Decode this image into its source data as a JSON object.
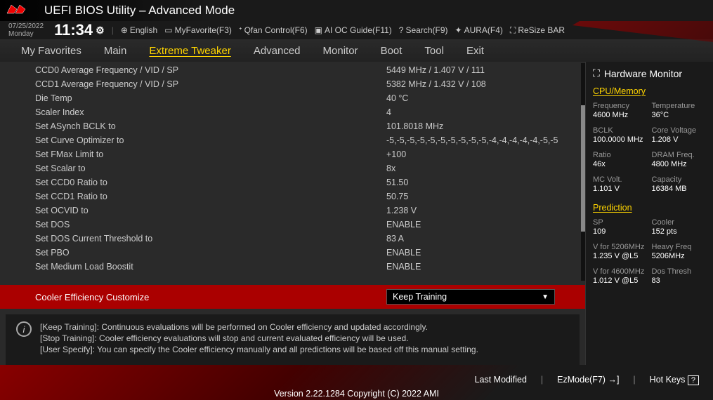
{
  "header": {
    "title": "UEFI BIOS Utility – Advanced Mode"
  },
  "datetime": {
    "date": "07/25/2022",
    "day": "Monday",
    "time": "11:34"
  },
  "toolbar": {
    "language": "English",
    "favorite": "MyFavorite(F3)",
    "qfan": "Qfan Control(F6)",
    "aioc": "AI OC Guide(F11)",
    "search": "Search(F9)",
    "aura": "AURA(F4)",
    "resize": "ReSize BAR"
  },
  "tabs": [
    "My Favorites",
    "Main",
    "Extreme Tweaker",
    "Advanced",
    "Monitor",
    "Boot",
    "Tool",
    "Exit"
  ],
  "active_tab": "Extreme Tweaker",
  "settings": [
    {
      "label": "CCD0 Average Frequency / VID / SP",
      "value": "5449 MHz / 1.407 V / 111"
    },
    {
      "label": "CCD1 Average Frequency / VID / SP",
      "value": "5382 MHz / 1.432 V / 108"
    },
    {
      "label": "Die Temp",
      "value": "40 °C"
    },
    {
      "label": "Scaler Index",
      "value": "4"
    },
    {
      "label": "Set ASynch BCLK to",
      "value": "101.8018 MHz"
    },
    {
      "label": "Set Curve Optimizer to",
      "value": "-5,-5,-5,-5,-5,-5,-5,-5,-5,-5,-4,-4,-4,-4,-4,-5,-5"
    },
    {
      "label": "Set FMax Limit to",
      "value": "+100"
    },
    {
      "label": "Set Scalar to",
      "value": "8x"
    },
    {
      "label": "Set CCD0 Ratio to",
      "value": "51.50"
    },
    {
      "label": "Set CCD1 Ratio to",
      "value": "50.75"
    },
    {
      "label": "Set OCVID to",
      "value": "1.238 V"
    },
    {
      "label": "Set DOS",
      "value": "ENABLE"
    },
    {
      "label": "Set DOS Current Threshold to",
      "value": "83 A"
    },
    {
      "label": "Set PBO",
      "value": "ENABLE"
    },
    {
      "label": "Set Medium Load Boostit",
      "value": "ENABLE"
    }
  ],
  "cooler": {
    "label": "Cooler Efficiency Customize",
    "value": "Keep Training"
  },
  "help": {
    "line1": "[Keep Training]: Continuous evaluations will be performed on Cooler efficiency and updated accordingly.",
    "line2": "[Stop Training]: Cooler efficiency evaluations will stop and current evaluated efficiency will be used.",
    "line3": "[User Specify]: You can specify the Cooler efficiency manually and all predictions will be based off this manual setting."
  },
  "hw_monitor": {
    "title": "Hardware Monitor",
    "cpu_section": "CPU/Memory",
    "cpu": [
      {
        "label": "Frequency",
        "value": "4600 MHz"
      },
      {
        "label": "Temperature",
        "value": "36°C"
      },
      {
        "label": "BCLK",
        "value": "100.0000 MHz"
      },
      {
        "label": "Core Voltage",
        "value": "1.208 V"
      },
      {
        "label": "Ratio",
        "value": "46x"
      },
      {
        "label": "DRAM Freq.",
        "value": "4800 MHz"
      },
      {
        "label": "MC Volt.",
        "value": "1.101 V"
      },
      {
        "label": "Capacity",
        "value": "16384 MB"
      }
    ],
    "pred_section": "Prediction",
    "pred": {
      "sp_label": "SP",
      "sp_value": "109",
      "cooler_label": "Cooler",
      "cooler_value": "152 pts",
      "v1_label_pre": "V for ",
      "v1_hl": "5206MHz",
      "v1_val": "1.235 V @L5",
      "hf_label": "Heavy Freq",
      "hf_val": "5206MHz",
      "v2_label_pre": "V for ",
      "v2_hl": "4600MHz",
      "v2_val": "1.012 V @L5",
      "dt_label": "Dos Thresh",
      "dt_val": "83"
    }
  },
  "footer": {
    "last_modified": "Last Modified",
    "ezmode": "EzMode(F7)",
    "hotkeys": "Hot Keys",
    "version": "Version 2.22.1284 Copyright (C) 2022 AMI"
  }
}
